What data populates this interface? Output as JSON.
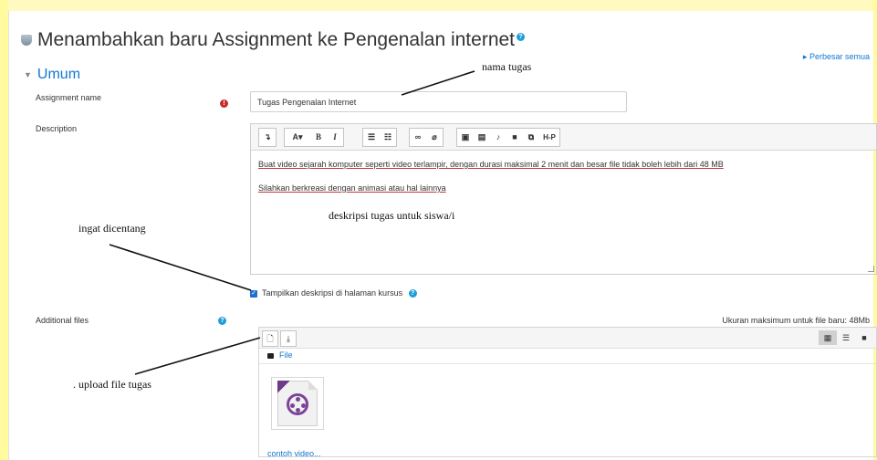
{
  "page": {
    "title": "Menambahkan baru Assignment ke Pengenalan internet",
    "expand_all": "Perbesar semua",
    "section_title": "Umum"
  },
  "fields": {
    "assignment_name_label": "Assignment name",
    "assignment_name_value": "Tugas Pengenalan Internet",
    "description_label": "Description",
    "description_lines": [
      "Buat video sejarah komputer seperti video terlampir, dengan durasi maksimal 2 menit dan besar file tidak boleh lebih dari 48 MB",
      "Silahkan berkreasi dengan animasi atau hal lainnya"
    ],
    "show_description_label": "Tampilkan deskripsi di halaman kursus",
    "show_description_checked": true,
    "additional_files_label": "Additional files",
    "max_size_text": "Ukuran maksimum untuk file baru: 48Mb"
  },
  "editor_toolbar": {
    "groups": [
      [
        "collapse"
      ],
      [
        "font-style",
        "bold",
        "italic"
      ],
      [
        "unordered-list",
        "ordered-list"
      ],
      [
        "link",
        "unlink"
      ],
      [
        "image",
        "media",
        "record-audio",
        "record-video",
        "manage-files",
        "h5p"
      ]
    ],
    "labels": {
      "bold": "B",
      "italic": "I",
      "font-style": "A▾",
      "h5p": "H-P",
      "collapse": "↴"
    }
  },
  "file_manager": {
    "path_label": "File",
    "files": [
      {
        "name": "contoh video...",
        "icon": "video-file-icon"
      }
    ],
    "views": [
      "icons",
      "list",
      "tree"
    ],
    "active_view": "icons"
  },
  "annotations": {
    "assignment_name_note": "nama  tugas",
    "description_note": "deskripsi  tugas  untuk  siswa/i",
    "checkbox_note": "ingat  dicentang",
    "upload_note": ".  upload  file  tugas"
  },
  "colors": {
    "link": "#1177d1",
    "required": "#c92b2b",
    "help": "#1f9ed8",
    "frame": "#fffb9e"
  }
}
